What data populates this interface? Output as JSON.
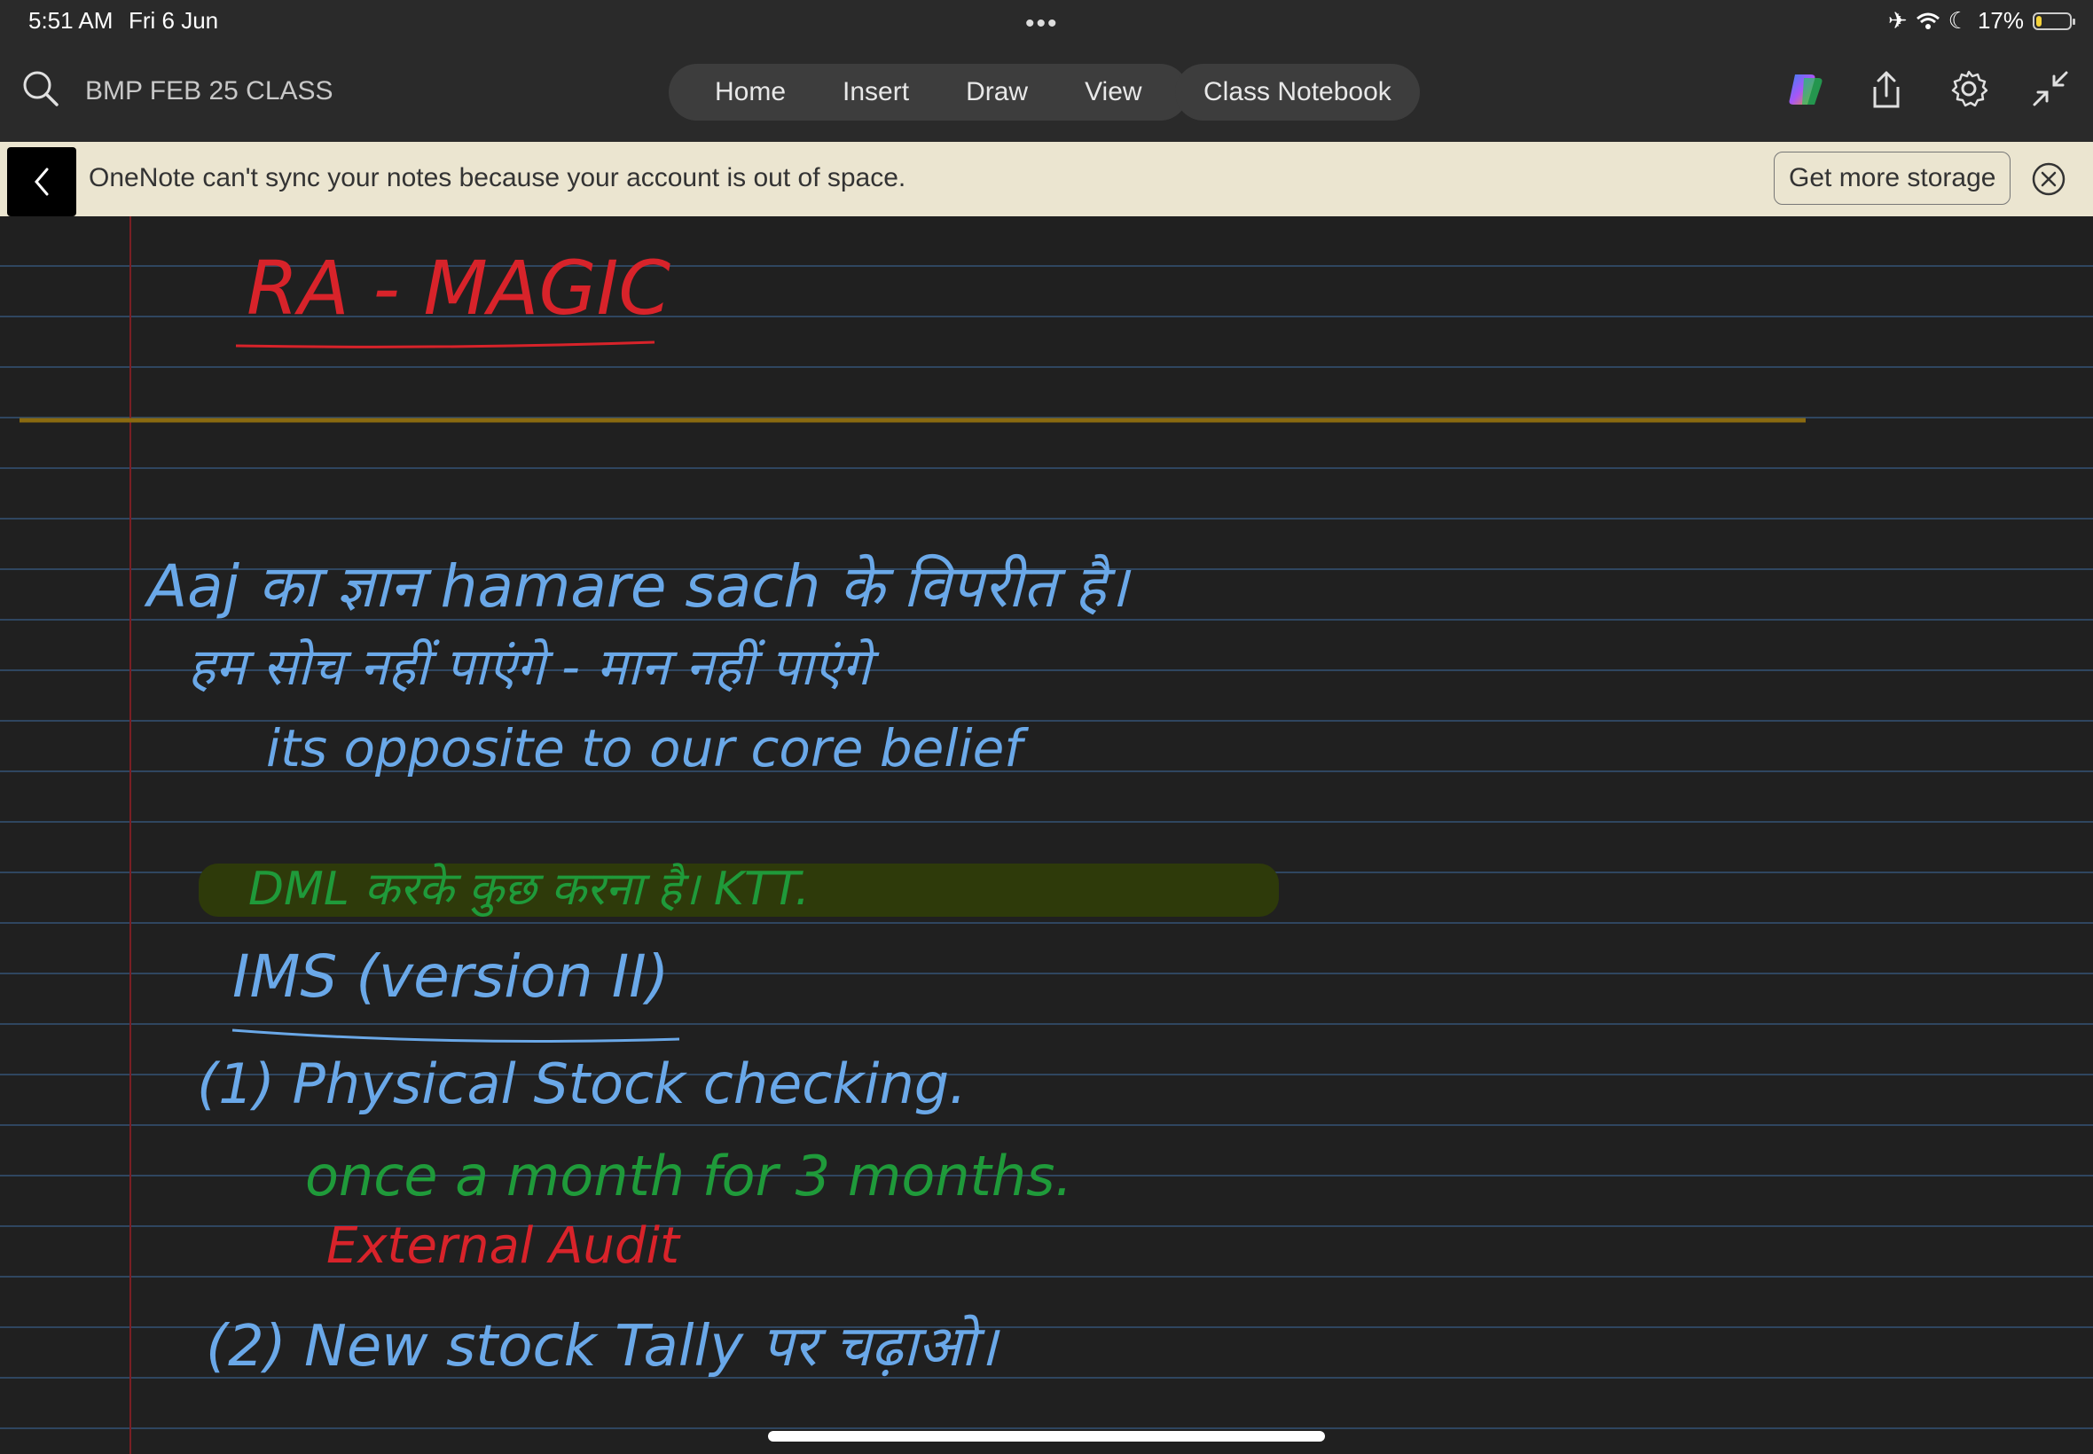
{
  "status_bar": {
    "time": "5:51 AM",
    "date": "Fri 6 Jun",
    "battery": "17%",
    "battery_level": 0.17
  },
  "toolbar": {
    "notebook_title": "BMP FEB 25 CLASS",
    "tabs": [
      {
        "label": "Home"
      },
      {
        "label": "Insert"
      },
      {
        "label": "Draw"
      },
      {
        "label": "View"
      }
    ],
    "class_notebook": "Class Notebook",
    "icons": [
      "search-icon",
      "copilot-icon",
      "share-icon",
      "settings-icon",
      "collapse-icon"
    ]
  },
  "banner": {
    "message": "OneNote can't sync your notes because your account is out of space.",
    "action": "Get more storage"
  },
  "notes": {
    "heading": "RA - MAGIC",
    "lines": [
      {
        "text": "Aaj का ज्ञान hamare sach के विपरीत है।"
      },
      {
        "text": "हम सोच नहीं पाएंगे - मान नहीं पाएंगे"
      },
      {
        "text": "its opposite to our core belief"
      },
      {
        "text": "DML करके कुछ करना है। KTT."
      },
      {
        "text": "IMS (version II)"
      },
      {
        "text": "(1) Physical Stock checking."
      },
      {
        "text": "once a month for 3 months."
      },
      {
        "text": "External Audit"
      },
      {
        "text": "(2) New stock Tally पर चढ़ाओ।"
      }
    ],
    "colors": {
      "red": "#d8232a",
      "blue": "#6aa8e8",
      "green": "#1f9a3a",
      "highlight": "#2e3a0a",
      "divider": "#8a6a10"
    }
  }
}
